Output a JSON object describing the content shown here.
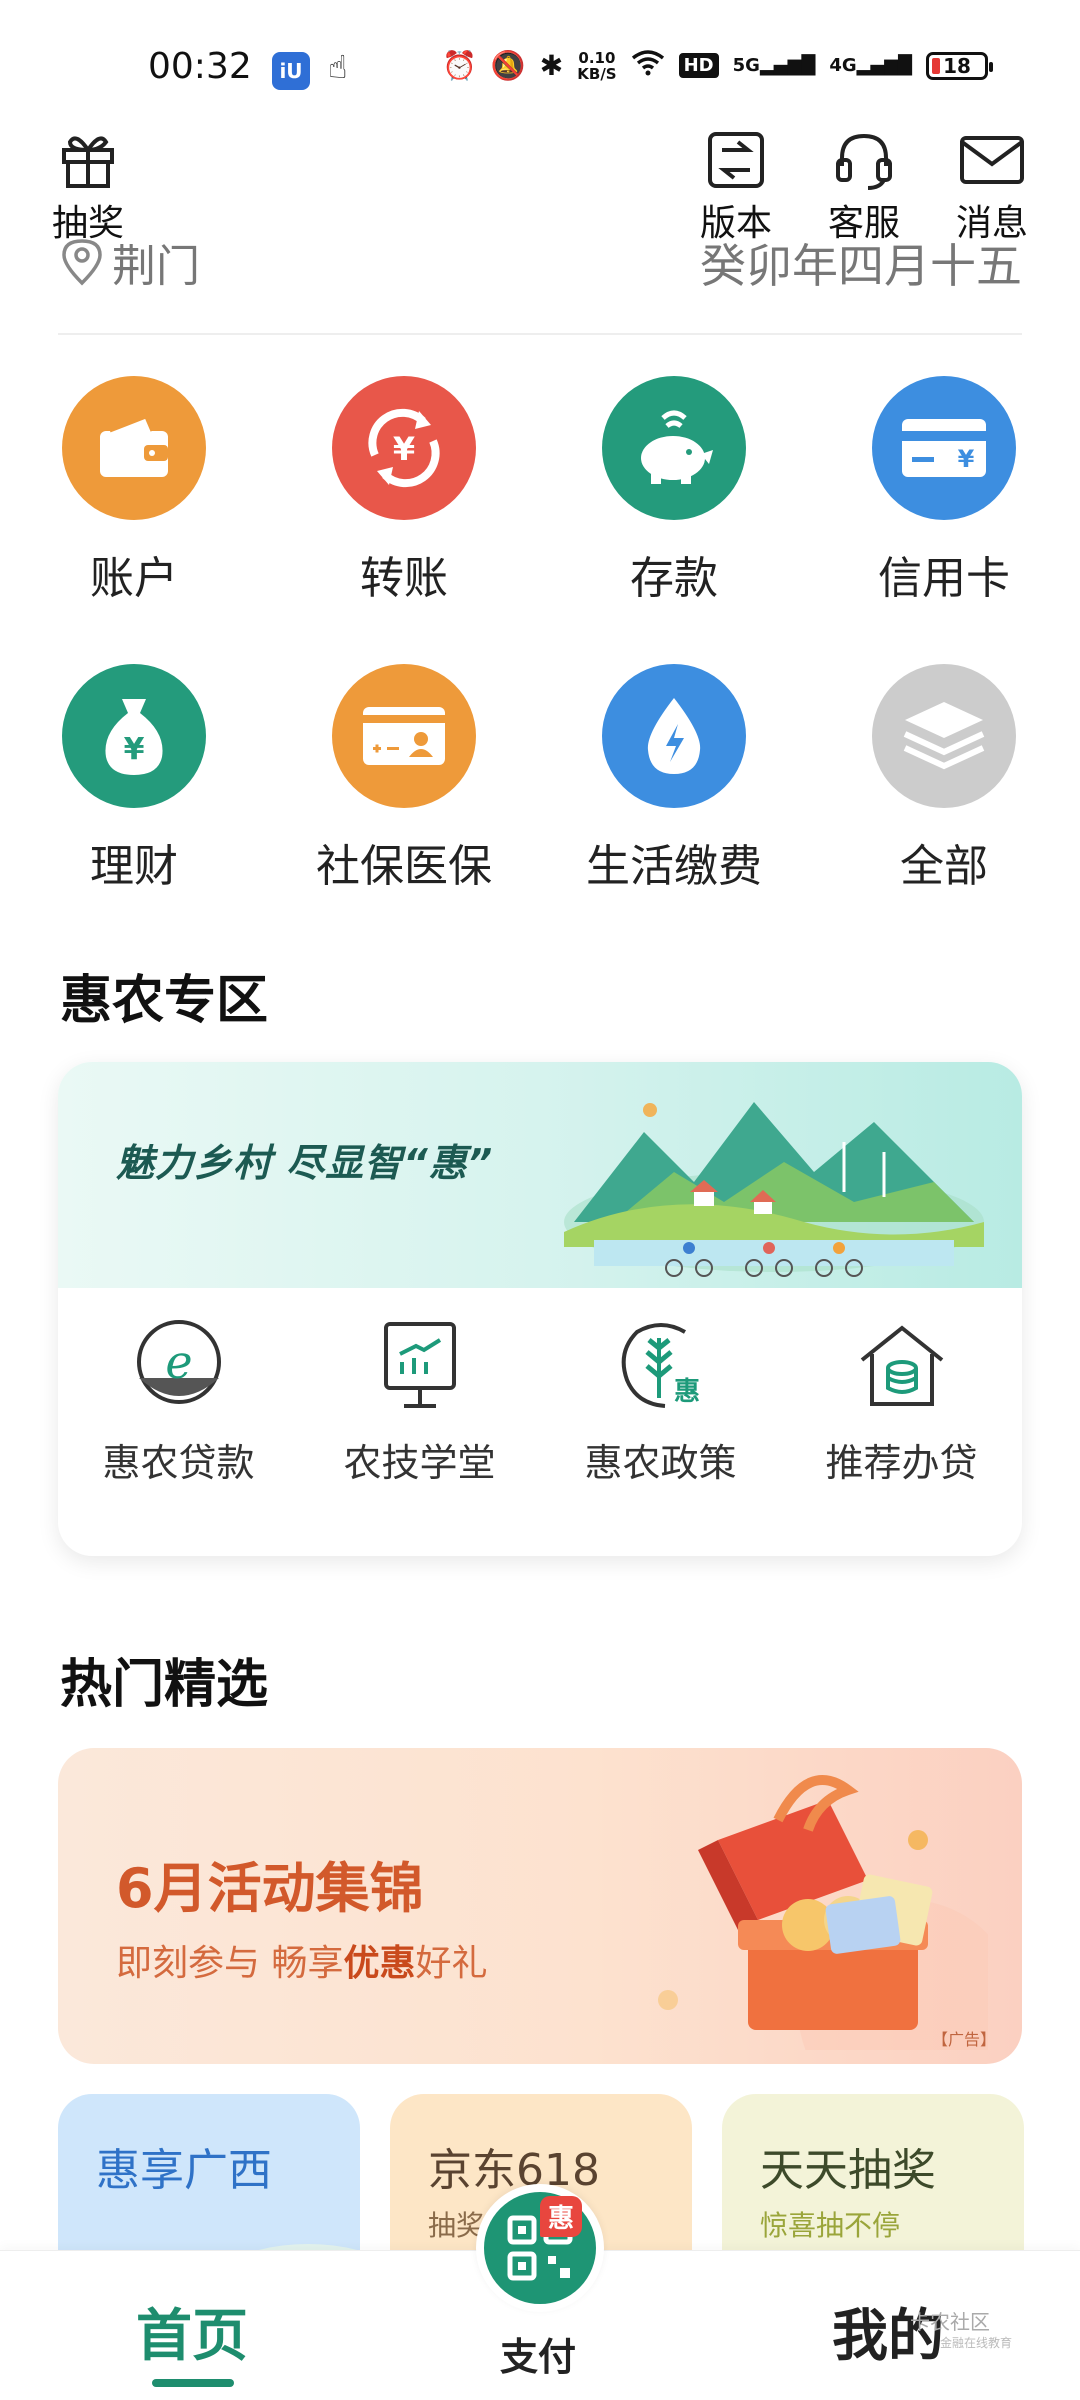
{
  "status": {
    "time": "00:32",
    "net_speed_value": "0.10",
    "net_speed_unit": "KB/S",
    "network_5g": "5G",
    "network_4g": "4G",
    "hd_label": "HD",
    "battery": "18"
  },
  "top": {
    "lottery": "抽奖",
    "version": "版本",
    "service": "客服",
    "message": "消息",
    "location": "荆门",
    "lunar_date": "癸卯年四月十五"
  },
  "grid": [
    {
      "label": "账户",
      "color": "#ee9a3a",
      "icon": "wallet-icon"
    },
    {
      "label": "转账",
      "color": "#e8574a",
      "icon": "yuan-exchange-icon"
    },
    {
      "label": "存款",
      "color": "#249b7c",
      "icon": "piggy-bank-icon"
    },
    {
      "label": "信用卡",
      "color": "#3d8ee0",
      "icon": "card-icon"
    },
    {
      "label": "理财",
      "color": "#249b7c",
      "icon": "money-bag-icon"
    },
    {
      "label": "社保医保",
      "color": "#ee9a3a",
      "icon": "id-card-icon"
    },
    {
      "label": "生活缴费",
      "color": "#3d8ee0",
      "icon": "water-drop-icon"
    },
    {
      "label": "全部",
      "color": "#cccccc",
      "icon": "layers-icon"
    }
  ],
  "huinong": {
    "title": "惠农专区",
    "banner_text": "魅力乡村  尽显智“惠”",
    "items": [
      {
        "label": "惠农贷款"
      },
      {
        "label": "农技学堂"
      },
      {
        "label": "惠农政策"
      },
      {
        "label": "推荐办贷"
      }
    ],
    "policy_badge": "惠",
    "loan_glyph": "e"
  },
  "hot": {
    "title": "热门精选",
    "promo_title": "6月活动集锦",
    "promo_sub_1": "即刻参与  畅享",
    "promo_sub_bold": "优惠",
    "promo_sub_2": "好礼",
    "promo_ad": "【广告】",
    "cards": [
      {
        "title": "惠享广西",
        "sub": "",
        "bg": "#cfe6fb",
        "color": "#2f72c7"
      },
      {
        "title": "京东618",
        "sub": "抽奖",
        "bg": "#fde6c6",
        "color": "#5a4330"
      },
      {
        "title": "天天抽奖",
        "sub": "惊喜抽不停",
        "bg": "#f3f3d8",
        "color": "#3d4a2a"
      }
    ]
  },
  "nav": {
    "home": "首页",
    "pay": "支付",
    "pay_badge": "惠",
    "mine": "我的"
  },
  "watermark": {
    "text": "卡农社区",
    "sub": "金融在线教育"
  }
}
